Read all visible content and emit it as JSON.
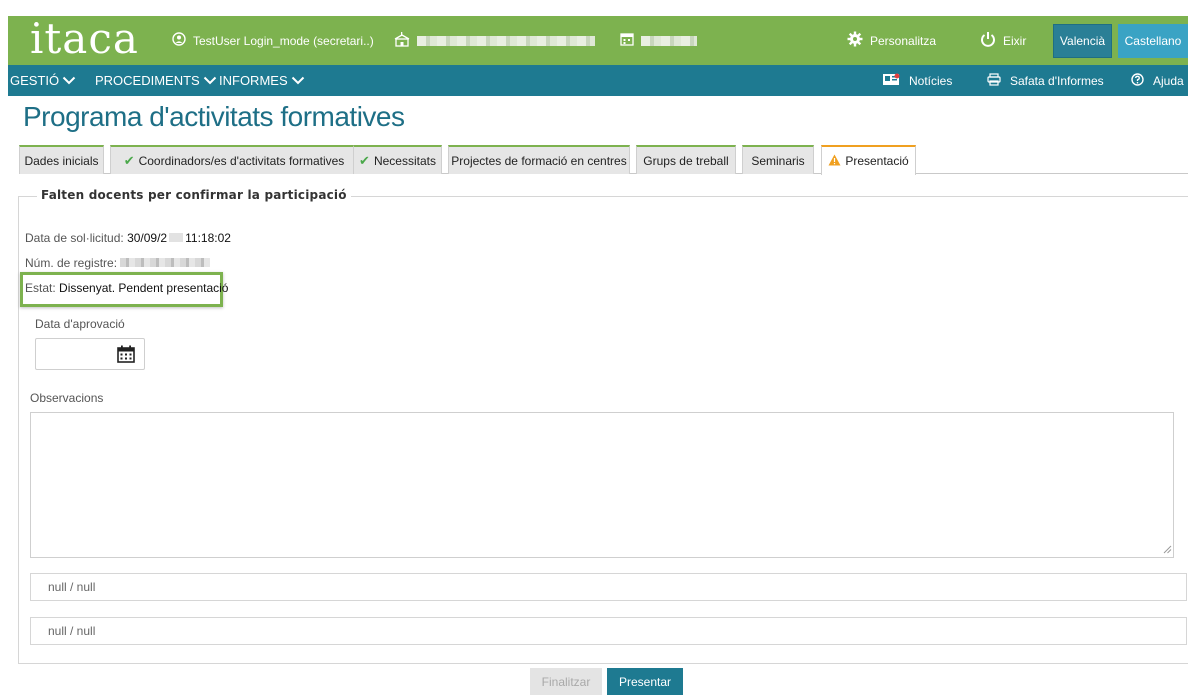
{
  "header": {
    "logo": "itaca",
    "user": "TestUser Login_mode (secretari..)",
    "personalize": "Personalitza",
    "exit": "Eixir",
    "lang_valencia": "Valencià",
    "lang_castellano": "Castellano",
    "brand_color": "#7db24f"
  },
  "menu": {
    "items": [
      "GESTIÓ",
      "PROCEDIMENTS",
      "INFORMES"
    ],
    "news": "Notícies",
    "reports_tray": "Safata d'Informes",
    "help": "Ajuda",
    "color": "#1e7a91"
  },
  "page": {
    "title": "Programa d'activitats formatives"
  },
  "tabs": [
    {
      "label": "Dades inicials",
      "status": "none"
    },
    {
      "label": "Coordinadors/es d'activitats formatives",
      "status": "check"
    },
    {
      "label": "Necessitats",
      "status": "check"
    },
    {
      "label": "Projectes de formació en centres",
      "status": "none"
    },
    {
      "label": "Grups de treball",
      "status": "none"
    },
    {
      "label": "Seminaris",
      "status": "none"
    },
    {
      "label": "Presentació",
      "status": "warning",
      "active": true
    }
  ],
  "form": {
    "legend": "Falten docents per confirmar la participació",
    "request_date_label": "Data de sol·licitud:",
    "request_date_value_start": "30/09/2",
    "request_date_value_end": "11:18:02",
    "registry_label": "Núm. de registre:",
    "state_label": "Estat:",
    "state_value": "Dissenyat. Pendent presentació",
    "approval_date_label": "Data d'aprovació",
    "approval_date_value": "",
    "observations_label": "Observacions",
    "observations_value": "",
    "null_field_1": "null / null",
    "null_field_2": "null / null"
  },
  "actions": {
    "finalize": "Finalitzar",
    "present": "Presentar"
  }
}
